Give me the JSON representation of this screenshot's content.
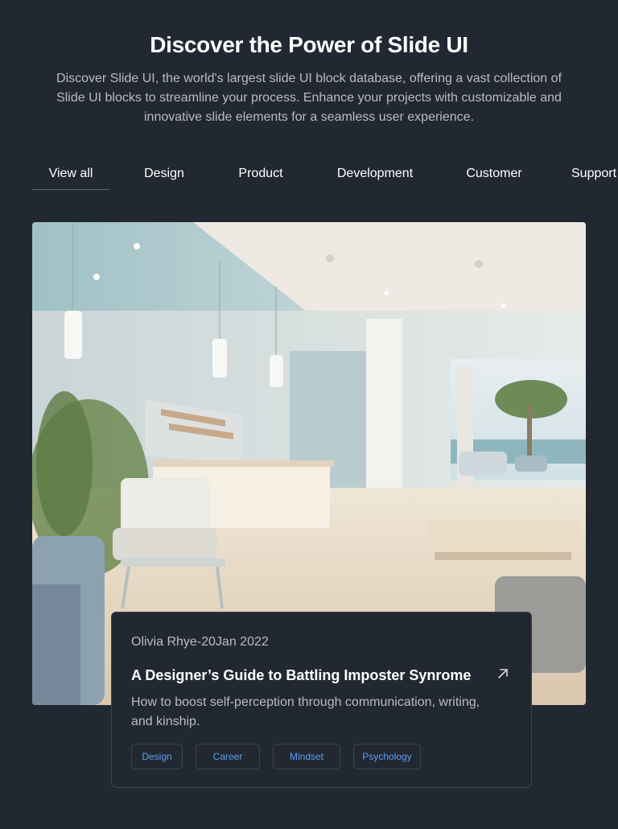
{
  "hero": {
    "title": "Discover the Power of Slide UI",
    "description": "Discover Slide UI, the world's largest slide UI block database, offering a vast collection of Slide UI blocks to streamline your process. Enhance your projects with customizable and innovative slide elements for a seamless user experience."
  },
  "tabs": [
    {
      "label": "View all",
      "active": true
    },
    {
      "label": "Design",
      "active": false
    },
    {
      "label": "Product",
      "active": false
    },
    {
      "label": "Development",
      "active": false
    },
    {
      "label": "Customer",
      "active": false
    },
    {
      "label": "Support",
      "active": false
    }
  ],
  "post": {
    "meta": "Olivia Rhye-20Jan 2022",
    "title": "A Designer’s Guide to Battling Imposter Synrome",
    "description": "How to boost self-perception through communication, writing, and kinship.",
    "tags": [
      "Design",
      "Career",
      "Mindset",
      "Psychology"
    ],
    "link_icon": "arrow-up-right-icon"
  },
  "colors": {
    "background": "#222831",
    "tag_text": "#5b9ef5",
    "muted_text": "#b7bcc4"
  }
}
